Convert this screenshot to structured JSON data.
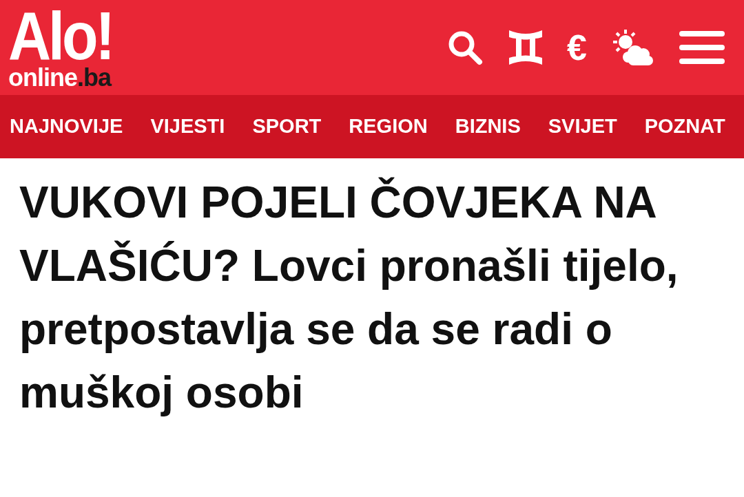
{
  "logo": {
    "title": "Alo!",
    "domain": "online",
    "tld": ".ba"
  },
  "header_icons": {
    "currency": "€"
  },
  "nav": [
    {
      "label": "NAJNOVIJE"
    },
    {
      "label": "VIJESTI"
    },
    {
      "label": "SPORT"
    },
    {
      "label": "REGION"
    },
    {
      "label": "BIZNIS"
    },
    {
      "label": "SVIJET"
    },
    {
      "label": "POZNAT"
    }
  ],
  "headline": "VUKOVI POJELI ČOVJEKA NA VLAŠIĆU? Lovci pronašli tijelo, pretpostavlja se da se radi o muškoj osobi"
}
